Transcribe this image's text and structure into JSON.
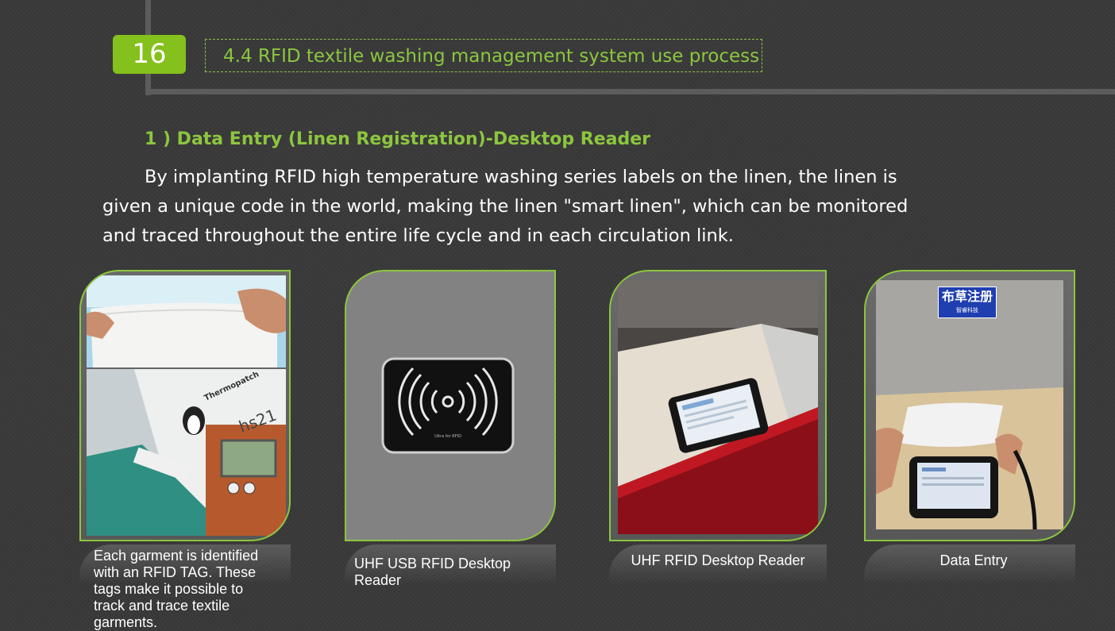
{
  "slide": {
    "page_number": "16",
    "section_title": "4.4 RFID textile washing management system use process",
    "subheading": "1 ) Data Entry (Linen Registration)-Desktop Reader",
    "paragraph": "By implanting RFID high temperature washing series labels on the linen, the linen is given a unique code in the world, making the linen \"smart linen\", which can be monitored and traced throughout the entire life cycle and in each circulation link."
  },
  "cards": [
    {
      "caption": "Each garment is identified with an RFID TAG. These tags make it possible to track and trace textile garments."
    },
    {
      "caption": "UHF  USB RFID Desktop Reader"
    },
    {
      "caption": "UHF RFID Desktop Reader"
    },
    {
      "caption": "Data Entry"
    }
  ],
  "photo_text": {
    "brand_tag": "Thermopatch",
    "machine_label": "hs21",
    "reader_label": "Ultra for RFID",
    "sign_main": "布草注册",
    "sign_sub": "智睿科技"
  },
  "colors": {
    "accent": "#8cc63f",
    "page_badge": "#84c11c",
    "background": "#3a3a3a"
  }
}
